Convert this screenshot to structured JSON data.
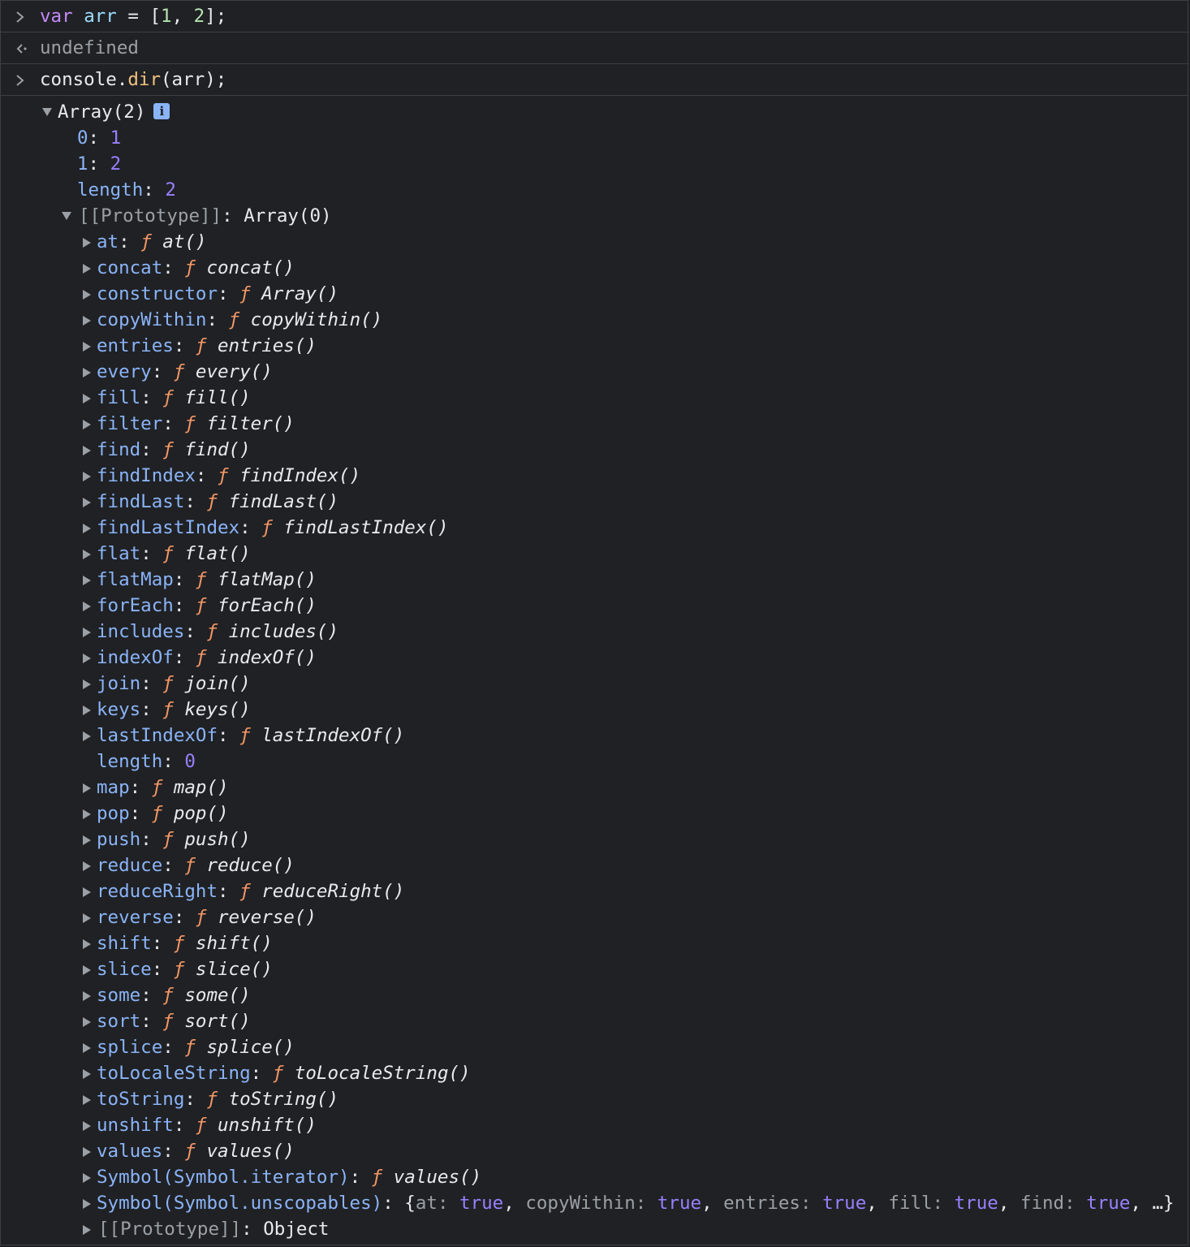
{
  "console": {
    "entries": [
      {
        "kind": "input",
        "code_parts": {
          "kw": "var",
          "name": "arr",
          "eq": " = ",
          "open": "[",
          "a": "1",
          "sep": ", ",
          "b": "2",
          "close": "];"
        }
      },
      {
        "kind": "result",
        "text": "undefined"
      },
      {
        "kind": "input",
        "code_parts": {
          "obj": "console.",
          "method": "dir",
          "args": "(arr);"
        }
      }
    ],
    "dir": {
      "header": "Array(2)",
      "info_icon": "info-icon",
      "items": [
        {
          "key": "0",
          "value": "1"
        },
        {
          "key": "1",
          "value": "2"
        },
        {
          "key": "length",
          "value": "2"
        }
      ],
      "prototype": {
        "key": "[[Prototype]]",
        "value": "Array(0)",
        "members": [
          {
            "key": "at",
            "fn": "at()"
          },
          {
            "key": "concat",
            "fn": "concat()"
          },
          {
            "key": "constructor",
            "fn": "Array()"
          },
          {
            "key": "copyWithin",
            "fn": "copyWithin()"
          },
          {
            "key": "entries",
            "fn": "entries()"
          },
          {
            "key": "every",
            "fn": "every()"
          },
          {
            "key": "fill",
            "fn": "fill()"
          },
          {
            "key": "filter",
            "fn": "filter()"
          },
          {
            "key": "find",
            "fn": "find()"
          },
          {
            "key": "findIndex",
            "fn": "findIndex()"
          },
          {
            "key": "findLast",
            "fn": "findLast()"
          },
          {
            "key": "findLastIndex",
            "fn": "findLastIndex()"
          },
          {
            "key": "flat",
            "fn": "flat()"
          },
          {
            "key": "flatMap",
            "fn": "flatMap()"
          },
          {
            "key": "forEach",
            "fn": "forEach()"
          },
          {
            "key": "includes",
            "fn": "includes()"
          },
          {
            "key": "indexOf",
            "fn": "indexOf()"
          },
          {
            "key": "join",
            "fn": "join()"
          },
          {
            "key": "keys",
            "fn": "keys()"
          },
          {
            "key": "lastIndexOf",
            "fn": "lastIndexOf()"
          },
          {
            "key": "length",
            "num": "0"
          },
          {
            "key": "map",
            "fn": "map()"
          },
          {
            "key": "pop",
            "fn": "pop()"
          },
          {
            "key": "push",
            "fn": "push()"
          },
          {
            "key": "reduce",
            "fn": "reduce()"
          },
          {
            "key": "reduceRight",
            "fn": "reduceRight()"
          },
          {
            "key": "reverse",
            "fn": "reverse()"
          },
          {
            "key": "shift",
            "fn": "shift()"
          },
          {
            "key": "slice",
            "fn": "slice()"
          },
          {
            "key": "some",
            "fn": "some()"
          },
          {
            "key": "sort",
            "fn": "sort()"
          },
          {
            "key": "splice",
            "fn": "splice()"
          },
          {
            "key": "toLocaleString",
            "fn": "toLocaleString()"
          },
          {
            "key": "toString",
            "fn": "toString()"
          },
          {
            "key": "unshift",
            "fn": "unshift()"
          },
          {
            "key": "values",
            "fn": "values()"
          },
          {
            "key": "Symbol(Symbol.iterator)",
            "fn": "values()"
          },
          {
            "key": "Symbol(Symbol.unscopables)",
            "unscopables": [
              {
                "k": "at",
                "v": "true"
              },
              {
                "k": "copyWithin",
                "v": "true"
              },
              {
                "k": "entries",
                "v": "true"
              },
              {
                "k": "fill",
                "v": "true"
              },
              {
                "k": "find",
                "v": "true"
              }
            ],
            "ellipsis": "…}"
          }
        ],
        "last": {
          "key": "[[Prototype]]",
          "value": "Object"
        }
      }
    },
    "colors": {
      "background": "#202124",
      "key": "#8ab4f8",
      "function_f": "#f29766",
      "number": "#9980ff",
      "keyword": "#c58af9",
      "method": "#f2c37f"
    }
  }
}
